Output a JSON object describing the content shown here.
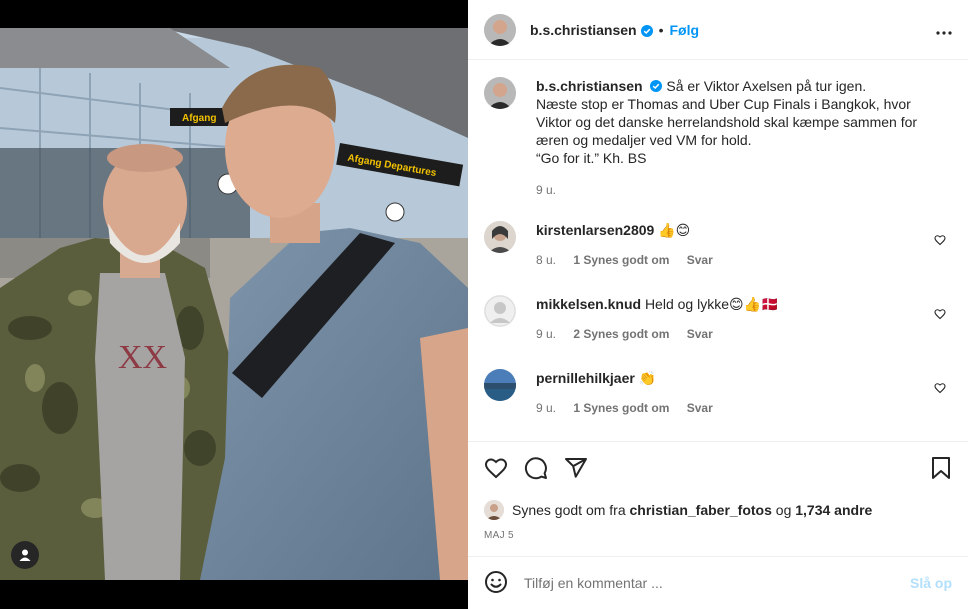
{
  "post": {
    "author": "b.s.christiansen",
    "follow_label": "Følg",
    "dot": "•",
    "more_icon": "more-horizontal-icon"
  },
  "caption": {
    "username": "b.s.christiansen",
    "line1": "Så er Viktor Axelsen på tur igen.",
    "line2": "Næste stop er Thomas and Uber Cup Finals i Bangkok, hvor",
    "line3": "Viktor og det danske herrelandshold skal kæmpe sammen for",
    "line4": "æren og medaljer ved VM for hold.",
    "line5": "“Go for it.” Kh. BS",
    "time": "9 u."
  },
  "comments": [
    {
      "username": "kirstenlarsen2809",
      "text": "👍😊",
      "time": "8 u.",
      "likes": "1 Synes godt om",
      "reply": "Svar"
    },
    {
      "username": "mikkelsen.knud",
      "text": "Held og lykke😊👍🇩🇰",
      "time": "9 u.",
      "likes": "2 Synes godt om",
      "reply": "Svar"
    },
    {
      "username": "pernillehilkjaer",
      "text": "👏",
      "time": "9 u.",
      "likes": "1 Synes godt om",
      "reply": "Svar"
    }
  ],
  "likes": {
    "prefix": "Synes godt om fra",
    "user": "christian_faber_fotos",
    "mid": "og",
    "others": "1,734 andre"
  },
  "date": "MAJ 5",
  "add_comment": {
    "placeholder": "Tilføj en kommentar ...",
    "post_label": "Slå op"
  },
  "photo_signs": {
    "sign1": "Afgang",
    "sign2": "Afgang Departures"
  },
  "colors": {
    "accent": "#0095f6",
    "post_disabled": "#b2dffc",
    "muted": "#737373"
  }
}
